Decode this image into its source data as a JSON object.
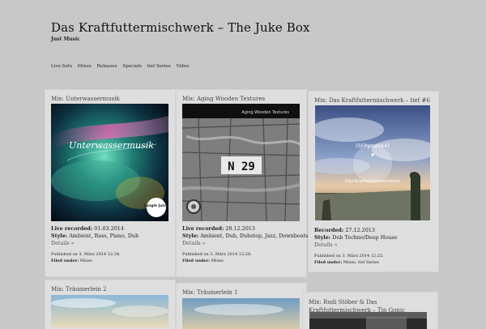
{
  "site": {
    "title": "Das Kraftfuttermischwerk – The Juke Box",
    "tagline": "Just Music"
  },
  "nav": {
    "items": [
      "Live-Sets",
      "Mixes",
      "Releases",
      "Specials",
      "tief Series",
      "Video"
    ]
  },
  "posts": [
    {
      "title": "Mix: Unterwassermusik",
      "image_text": "Unterwassermusik",
      "badge_text": "Jungle Juice",
      "line1_label": "Live recorded:",
      "line1_value": "01.03.2014",
      "style_label": "Style:",
      "style_value": "Ambient, Bass, Piano, Dub",
      "details": "Details »",
      "published": "Published on 3. März 2014 12:34.",
      "filed_label": "Filed under:",
      "filed_value": "Mixes"
    },
    {
      "title": "Mix: Aging Wooden Textures",
      "image_text": "Aging Wooden Textures",
      "sign_text": "N 29",
      "line1_label": "Live recorded:",
      "line1_value": "28.12.2013",
      "style_label": "Style:",
      "style_value": "Ambient, Dub, Dubstep, Jazz, Downbeats",
      "details": "Details »",
      "published": "Published on 3. März 2014 12:28.",
      "filed_label": "Filed under:",
      "filed_value": "Mixes"
    },
    {
      "title": "Mix: Das Kraftfuttermischwerk – tief #6",
      "image_code": "[SFPpod044]",
      "image_name": "Das Kraftfuttermischwerk",
      "line1_label": "Recorded:",
      "line1_value": "27.12.2013",
      "style_label": "Style:",
      "style_value": "Dub Techno/Deep House",
      "details": "Details »",
      "published": "Published on 3. März 2014 12:25.",
      "filed_label": "Filed under:",
      "filed_value": "Mixes, tief Series"
    },
    {
      "title": "Mix: Träumerlein 2"
    },
    {
      "title": "Mix: Träumerlein 1"
    },
    {
      "title": "Mix: Rudi Stöber & Das Kraftfuttermischwerk – Tin Gonic"
    }
  ]
}
